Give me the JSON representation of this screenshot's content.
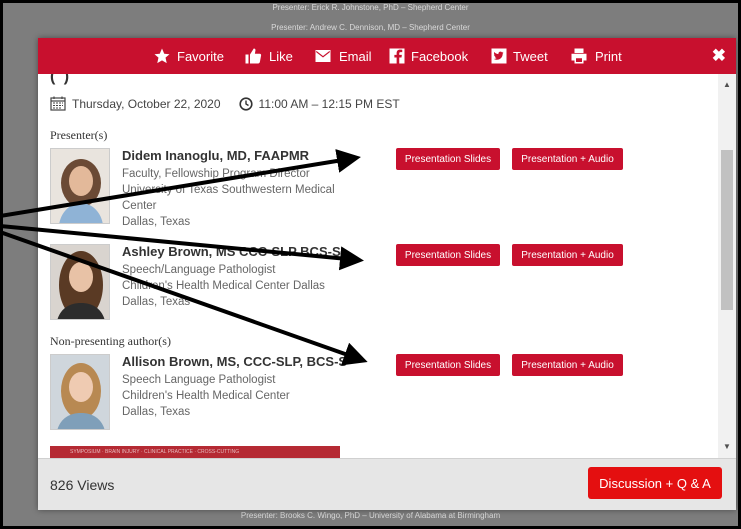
{
  "background": {
    "top_line_1": "Presenter: Erick R. Johnstone, PhD – Shepherd Center",
    "top_line_2": "Presenter: Andrew C. Dennison, MD – Shepherd Center",
    "bottom_line": "Presenter: Brooks C. Wingo, PhD – University of Alabama at Birmingham"
  },
  "toolbar": {
    "favorite": "Favorite",
    "like": "Like",
    "email": "Email",
    "facebook": "Facebook",
    "tweet": "Tweet",
    "print": "Print",
    "close": "✖"
  },
  "session": {
    "title_fragment": "(          )",
    "date": "Thursday, October 22, 2020",
    "time": "11:00 AM – 12:15 PM EST"
  },
  "sections": {
    "presenters": "Presenter(s)",
    "non_presenting": "Non-presenting author(s)"
  },
  "people": [
    {
      "name": "Didem Inanoglu, MD, FAAPMR",
      "line1": "Faculty, Fellowship Program Director",
      "line2": "University of Texas Southwestern Medical",
      "line3": "Center",
      "line4": "Dallas, Texas"
    },
    {
      "name": "Ashley Brown, MS CCC-SLP BCS-S",
      "line1": "Speech/Language Pathologist",
      "line2": "Children's Health Medical Center Dallas",
      "line3": "Dallas, Texas"
    },
    {
      "name": "Allison Brown, MS, CCC-SLP, BCS-S",
      "line1": "Speech Language Pathologist",
      "line2": "Children's Health Medical Center",
      "line3": "Dallas, Texas"
    }
  ],
  "buttons": {
    "slides": "Presentation Slides",
    "audio": "Presentation + Audio"
  },
  "banner_text": "SYMPOSIUM · BRAIN INJURY · CLINICAL PRACTICE · CROSS-CUTTING",
  "footer": {
    "views": "826 Views",
    "discussion": "Discussion + Q & A"
  },
  "colors": {
    "accent": "#c8102e",
    "discussion": "#e40f10"
  }
}
